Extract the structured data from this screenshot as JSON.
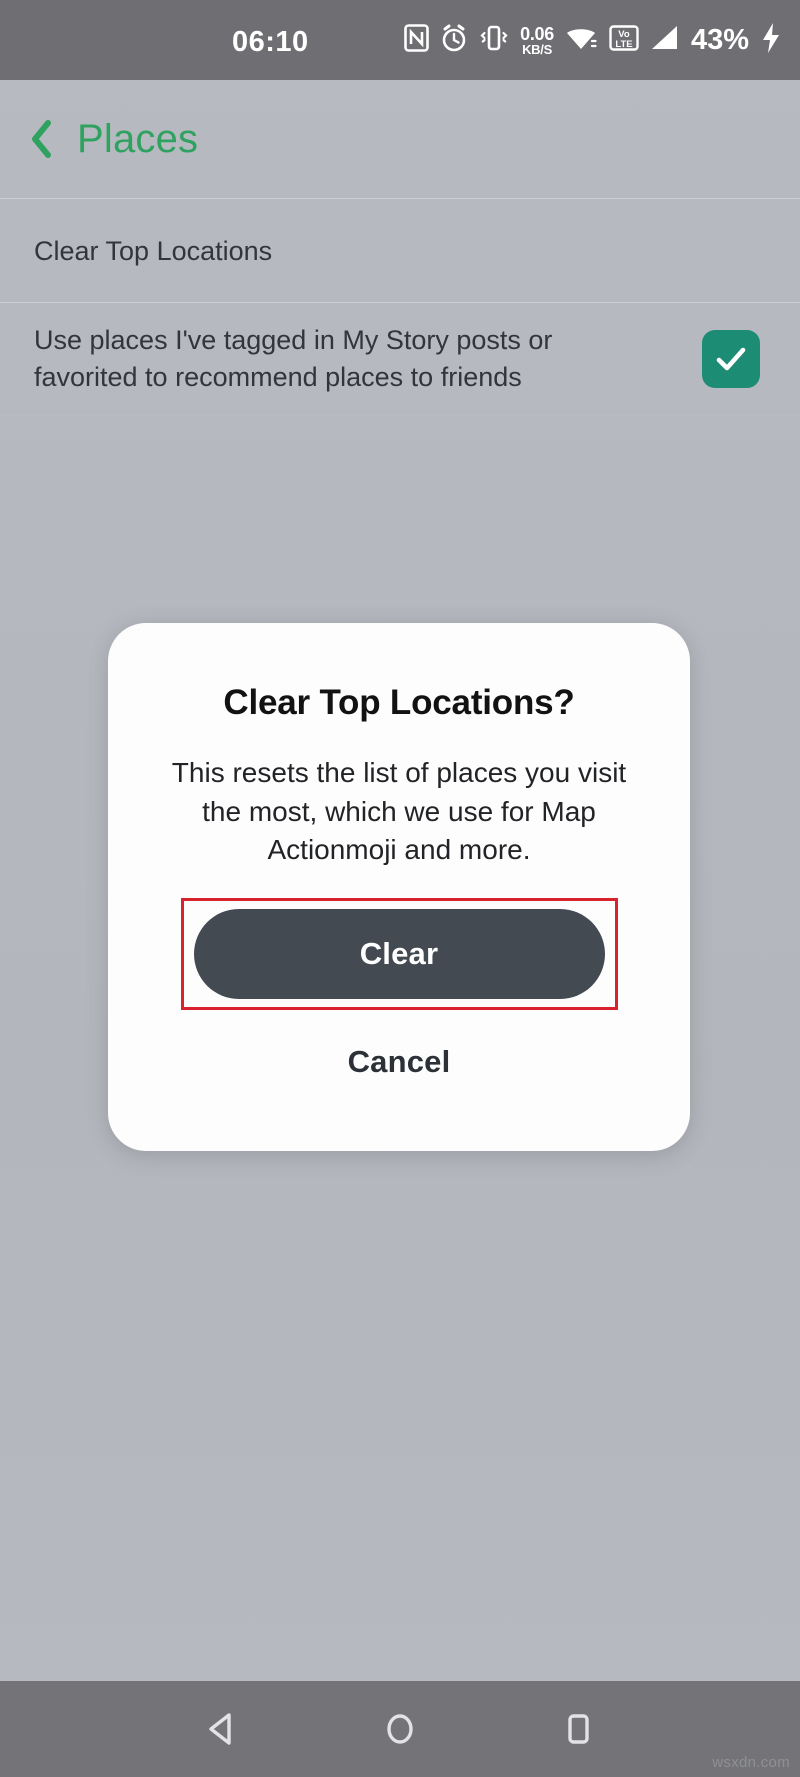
{
  "status_bar": {
    "clock": "06:10",
    "net_speed_value": "0.06",
    "net_speed_unit": "KB/S",
    "volte_top": "Vo",
    "volte_sup": "LTE",
    "battery_percent": "43%",
    "icons": [
      "nfc-icon",
      "alarm-icon",
      "vibrate-icon",
      "net-speed-indicator",
      "wifi-icon",
      "volte-icon",
      "cellular-signal-icon",
      "battery-percent",
      "charging-bolt-icon"
    ],
    "background_color": "#6e6e73"
  },
  "app_header": {
    "title": "Places",
    "title_color": "#2fa260",
    "back_icon": "chevron-left-icon"
  },
  "settings": {
    "clear_top_locations_label": "Clear Top Locations",
    "recommend_places_label": "Use places I've tagged in My Story posts or favorited to recommend places to friends",
    "recommend_places_checked": true,
    "checkbox_color": "#1d8c74"
  },
  "dialog": {
    "title": "Clear Top Locations?",
    "body": "This resets the list of places you visit the most, which we use for Map Actionmoji and more.",
    "primary_label": "Clear",
    "secondary_label": "Cancel",
    "primary_color": "#434a52",
    "highlight_color": "#d8232f",
    "background_color": "#fdfdfd"
  },
  "nav_bar": {
    "back_icon": "triangle-back-icon",
    "home_icon": "circle-home-icon",
    "recents_icon": "square-recents-icon",
    "background_color": "#747478"
  },
  "watermark": {
    "text": "wsxdn.com"
  }
}
